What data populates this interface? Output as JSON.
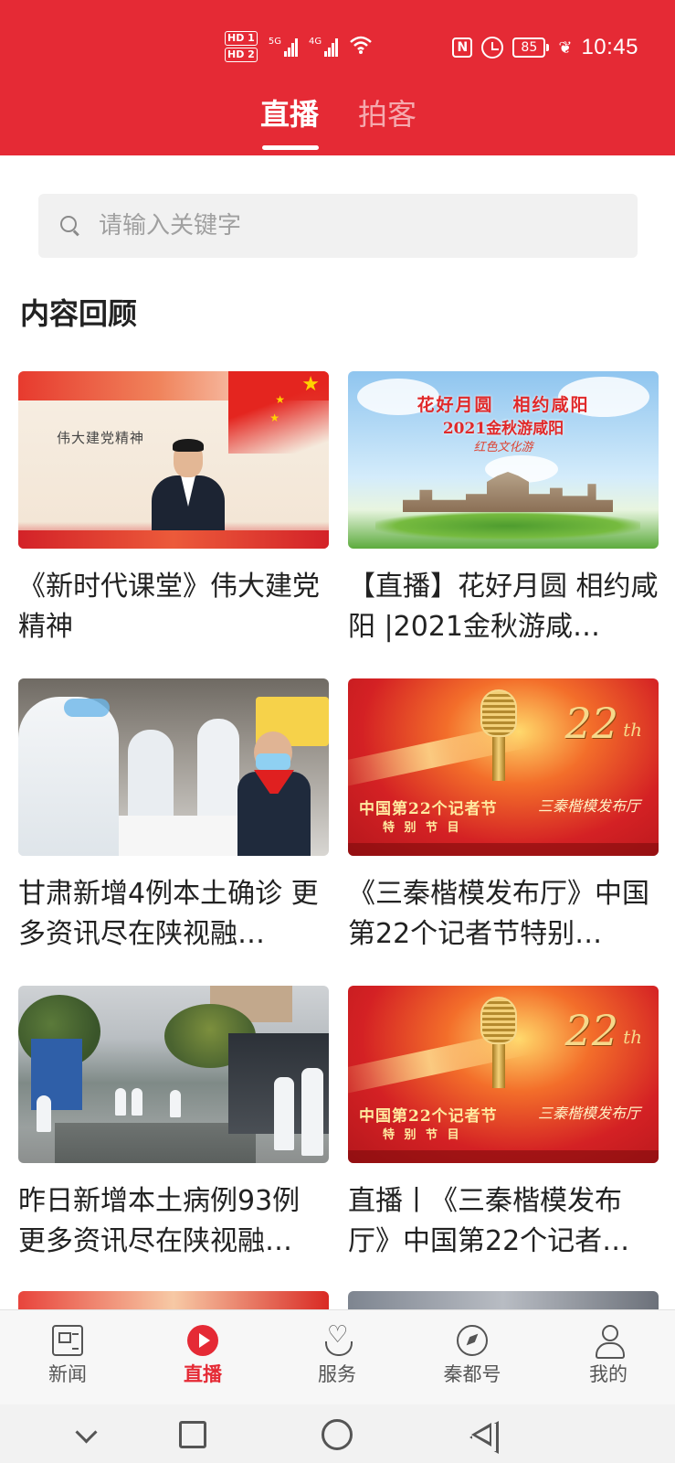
{
  "status_bar": {
    "hd1": "HD 1",
    "hd2": "HD 2",
    "net1": "5G",
    "net2": "4G",
    "nfc": "N",
    "battery": "85",
    "time": "10:45"
  },
  "tabs": [
    {
      "label": "直播",
      "active": true
    },
    {
      "label": "拍客",
      "active": false
    }
  ],
  "search": {
    "placeholder": "请输入关键字"
  },
  "section_title": "内容回顾",
  "cards": [
    {
      "title": "《新时代课堂》伟大建党精神",
      "thumb_icon": "lecture-thumbnail",
      "thumb_text": "伟大建党精神"
    },
    {
      "title": "【直播】花好月圆 相约咸阳 |2021金秋游咸…",
      "thumb_icon": "festival-thumbnail",
      "thumb_text_1": "花好月圆　相约咸阳",
      "thumb_text_2": "2021金秋游咸阳",
      "thumb_text_3": "红色文化游"
    },
    {
      "title": "甘肃新增4例本土确诊 更多资讯尽在陕视融…",
      "thumb_icon": "covid-testing-thumbnail"
    },
    {
      "title": "《三秦楷模发布厅》中国第22个记者节特别…",
      "thumb_icon": "journalist-day-thumbnail",
      "thumb_text_1": "中国第22个记者节",
      "thumb_text_2": "特 别 节 目",
      "thumb_text_3": "三秦楷模发布厅",
      "thumb_num": "22",
      "thumb_sup": "th"
    },
    {
      "title": "昨日新增本土病例93例 更多资讯尽在陕视融…",
      "thumb_icon": "street-checkpoint-thumbnail"
    },
    {
      "title": "直播丨《三秦楷模发布厅》中国第22个记者…",
      "thumb_icon": "journalist-day-thumbnail",
      "thumb_text_1": "中国第22个记者节",
      "thumb_text_2": "特 别 节 目",
      "thumb_text_3": "三秦楷模发布厅",
      "thumb_num": "22",
      "thumb_sup": "th"
    }
  ],
  "bottom_nav": [
    {
      "label": "新闻",
      "icon": "newspaper-icon",
      "active": false
    },
    {
      "label": "直播",
      "icon": "play-circle-icon",
      "active": true
    },
    {
      "label": "服务",
      "icon": "heart-hand-icon",
      "active": false
    },
    {
      "label": "秦都号",
      "icon": "compass-icon",
      "active": false
    },
    {
      "label": "我的",
      "icon": "person-icon",
      "active": false
    }
  ],
  "colors": {
    "brand_red": "#e52a35",
    "text": "#222222",
    "muted": "#555555"
  }
}
